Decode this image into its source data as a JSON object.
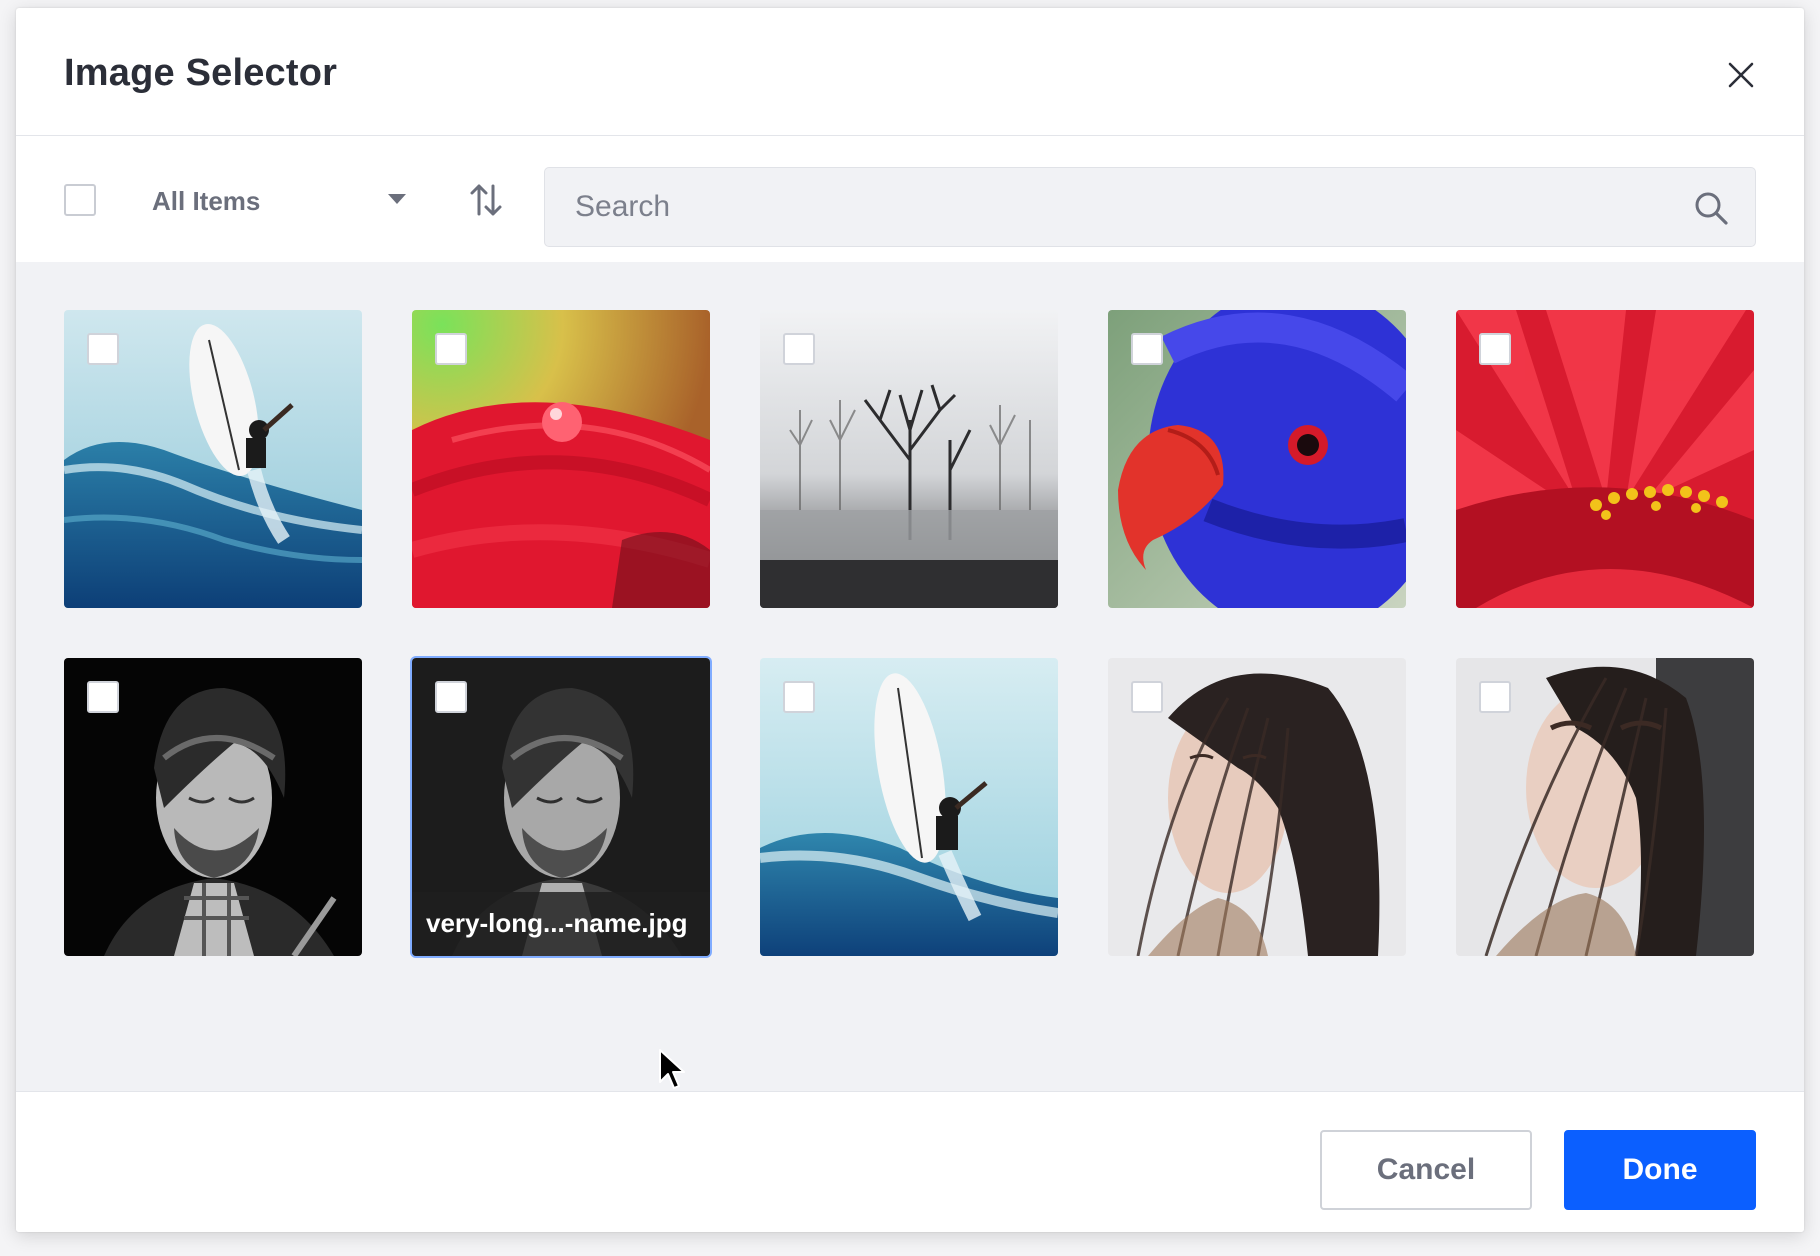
{
  "dialog": {
    "title": "Image Selector",
    "close_icon": "close-icon"
  },
  "toolbar": {
    "select_all_checked": false,
    "filter_label": "All Items",
    "filter_icon": "caret-down-icon",
    "sort_icon": "sort-arrows-icon",
    "search_placeholder": "Search",
    "search_value": "",
    "search_icon": "search-icon"
  },
  "images": [
    {
      "subject": "surfer",
      "checked": false,
      "name": ""
    },
    {
      "subject": "red-flower-droplet",
      "checked": false,
      "name": ""
    },
    {
      "subject": "frosty-trees",
      "checked": false,
      "name": ""
    },
    {
      "subject": "blue-parrot",
      "checked": false,
      "name": ""
    },
    {
      "subject": "red-gerbera",
      "checked": false,
      "name": ""
    },
    {
      "subject": "man-portrait-bw",
      "checked": false,
      "name": ""
    },
    {
      "subject": "man-portrait-bw",
      "checked": false,
      "name": "very-long...-name.jpg",
      "hovered": true
    },
    {
      "subject": "surfer",
      "checked": false,
      "name": ""
    },
    {
      "subject": "woman-hair",
      "checked": false,
      "name": ""
    },
    {
      "subject": "woman-hair",
      "checked": false,
      "name": ""
    }
  ],
  "footer": {
    "cancel_label": "Cancel",
    "done_label": "Done"
  },
  "colors": {
    "primary": "#0b5fff",
    "hover_border": "#80acff",
    "background": "#f1f2f5",
    "title_text": "#2b2e38",
    "secondary_text": "#6b6f7c"
  }
}
